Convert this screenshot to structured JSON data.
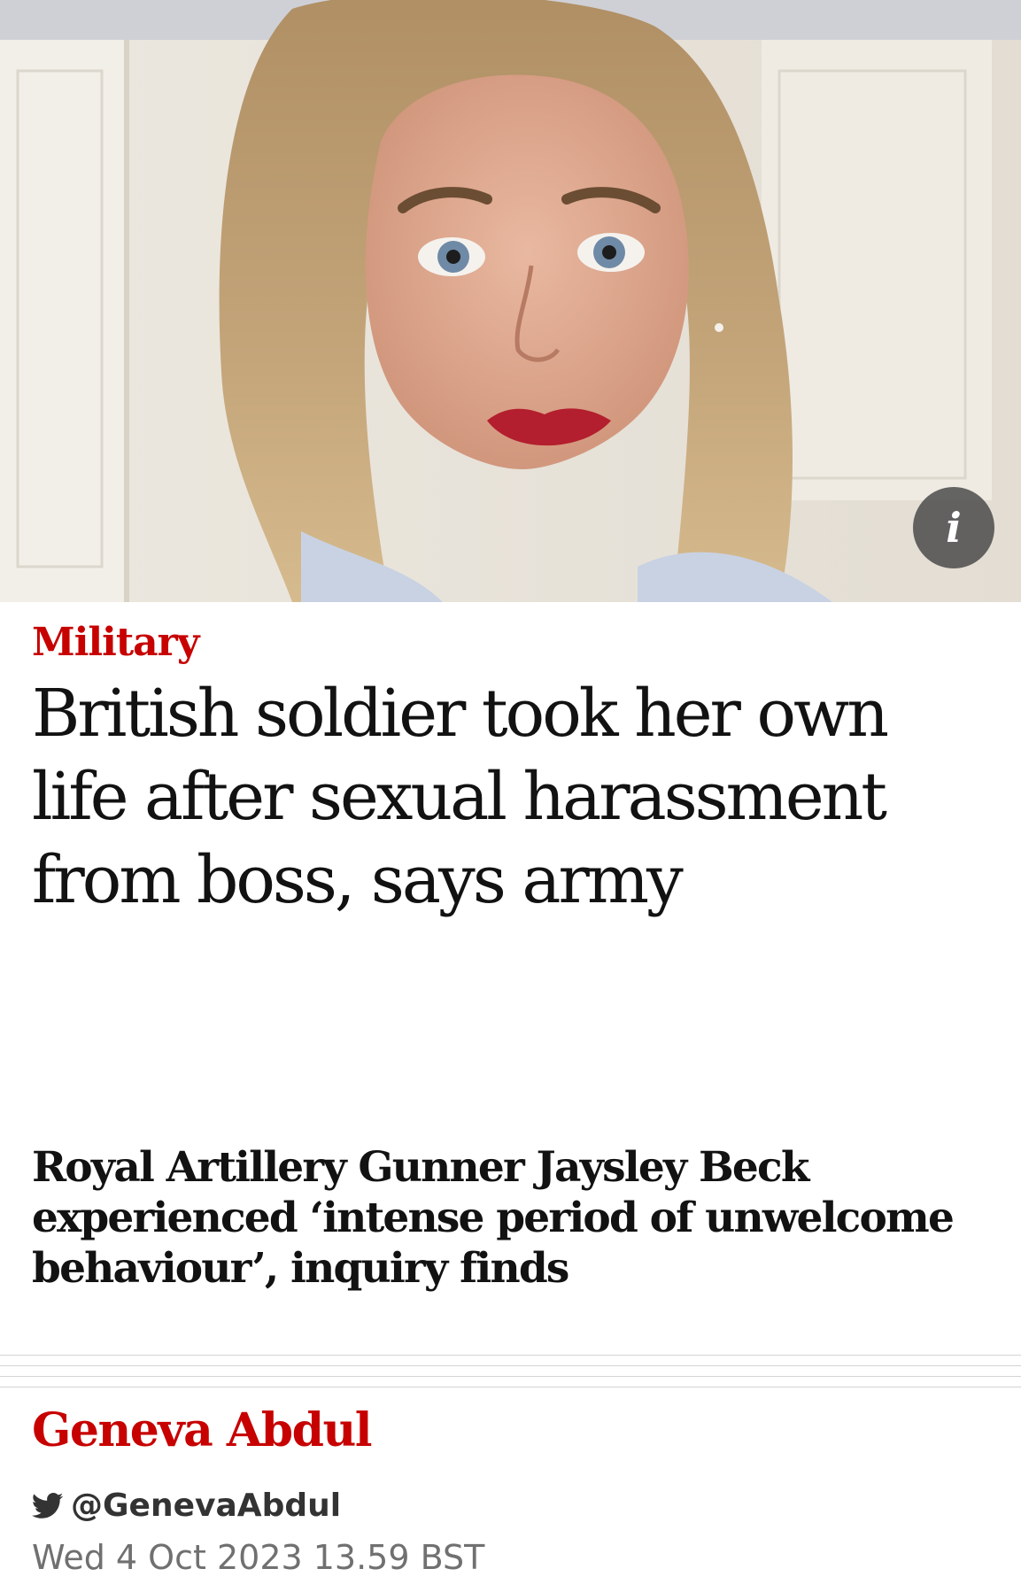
{
  "hero": {
    "info_icon_glyph": "i",
    "info_icon_name": "info-icon"
  },
  "article": {
    "section": "Military",
    "headline": "British soldier took her own life after sexual harassment from boss, says army",
    "standfirst": "Royal Artillery Gunner Jaysley Beck experienced ‘intense period of unwelcome behaviour’, inquiry finds",
    "author": "Geneva Abdul",
    "twitter_handle": "@GenevaAbdul",
    "twitter_icon": "twitter-bird-icon",
    "published": "Wed 4 Oct 2023 13.59 BST"
  },
  "colors": {
    "accent": "#c70000",
    "text": "#121212",
    "meta": "#707070"
  }
}
